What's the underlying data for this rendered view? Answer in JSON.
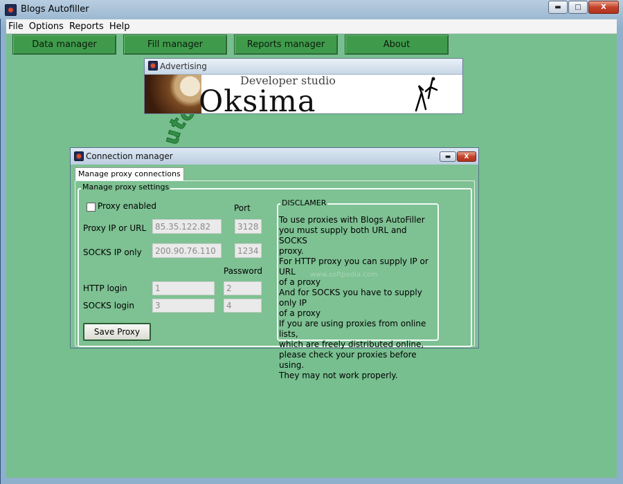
{
  "app": {
    "title": "Blogs Autofiller",
    "caption_buttons": {
      "minimize": "▬",
      "maximize": "□",
      "close": "X"
    }
  },
  "menu": [
    "File",
    "Options",
    "Reports",
    "Help"
  ],
  "toolbar": [
    "Data manager",
    "Fill manager",
    "Reports manager",
    "About"
  ],
  "advertising": {
    "title": "Advertising",
    "banner_tagline": "Developer studio",
    "banner_brand": "Oksima"
  },
  "watermark": {
    "text": "utofille"
  },
  "connection_manager": {
    "title": "Connection manager",
    "tab_label": "Manage proxy connections",
    "group_label": "Manage proxy settings",
    "proxy_enabled_label": "Proxy enabled",
    "proxy_enabled": false,
    "port_header": "Port",
    "password_header": "Password",
    "rows": {
      "proxy_ip": {
        "label": "Proxy IP or URL",
        "value": "85.35.122.82",
        "port": "3128"
      },
      "socks_ip": {
        "label": "SOCKS IP only",
        "value": "200.90.76.110",
        "port": "1234"
      },
      "http_login": {
        "label": "HTTP login",
        "value": "1",
        "password": "2"
      },
      "socks_login": {
        "label": "SOCKS login",
        "value": "3",
        "password": "4"
      }
    },
    "save_button": "Save Proxy",
    "disclaimer": {
      "title": "DISCLAMER",
      "text": "To use proxies with Blogs AutoFiller\nyou must supply both URL and SOCKS\nproxy.\nFor HTTP proxy you can supply IP or URL\nof a proxy\nAnd for SOCKS you have to supply only IP\nof a proxy\nIf you are using proxies from online lists,\nwhich are freely distributed online,\nplease check your proxies before using.\nThey may not work properly."
    },
    "faint_watermark": "www.softpedia.com"
  }
}
